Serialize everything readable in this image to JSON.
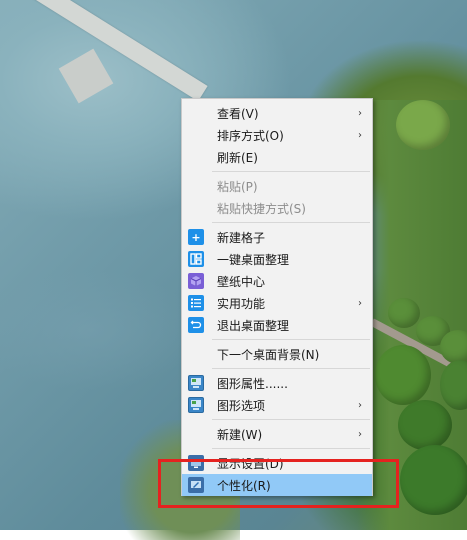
{
  "menu": {
    "items": [
      {
        "label": "查看(V)",
        "submenu": true
      },
      {
        "label": "排序方式(O)",
        "submenu": true
      },
      {
        "label": "刷新(E)"
      },
      {
        "label": "粘贴(P)",
        "disabled": true
      },
      {
        "label": "粘贴快捷方式(S)",
        "disabled": true
      },
      {
        "label": "新建格子",
        "icon": "plus-icon"
      },
      {
        "label": "一键桌面整理",
        "icon": "layout-grid-icon"
      },
      {
        "label": "壁纸中心",
        "icon": "wallpaper-cube-icon"
      },
      {
        "label": "实用功能",
        "icon": "list-icon",
        "submenu": true
      },
      {
        "label": "退出桌面整理",
        "icon": "exit-icon"
      },
      {
        "label": "下一个桌面背景(N)"
      },
      {
        "label": "图形属性......",
        "icon": "graphics-properties-icon"
      },
      {
        "label": "图形选项",
        "icon": "graphics-options-icon",
        "submenu": true
      },
      {
        "label": "新建(W)",
        "submenu": true
      },
      {
        "label": "显示设置(D)",
        "icon": "display-settings-icon"
      },
      {
        "label": "个性化(R)",
        "icon": "personalize-icon",
        "highlighted": true
      }
    ],
    "submenu_arrow": "›"
  },
  "colors": {
    "menu_background": "#f2f2f2",
    "highlight": "#91c9f7",
    "annotation": "#e5221f"
  }
}
